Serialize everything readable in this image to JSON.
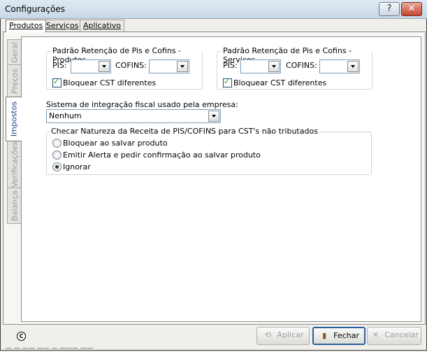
{
  "window": {
    "title": "Configurações",
    "help_btn": "?",
    "close_btn": "✕"
  },
  "top_tabs": [
    "Produtos",
    "Serviços",
    "Aplicativo"
  ],
  "side_tabs": [
    "Geral",
    "Preços",
    "Impostos",
    "Verificações",
    "Balança"
  ],
  "produtos_group": {
    "title": "Padrão Retenção de Pis e Cofins - Produtos",
    "pis_label": "PIS:",
    "pis_value": "",
    "cofins_label": "COFINS:",
    "cofins_value": "",
    "block_label": "Bloquear CST diferentes",
    "block_checked": true
  },
  "servicos_group": {
    "title": "Padrão Retenção de Pis e Cofins - Serviços",
    "pis_label": "PIS:",
    "pis_value": "",
    "cofins_label": "COFINS:",
    "cofins_value": "",
    "block_label": "Bloquear CST diferentes",
    "block_checked": true
  },
  "fiscal": {
    "label": "Sistema de integração fiscal usado pela empresa:",
    "value": "Nenhum"
  },
  "natureza": {
    "title": "Checar Natureza da Receita de PIS/COFINS para CST's não tributados",
    "options": [
      "Bloquear ao salvar produto",
      "Emitir Alerta e pedir confirmação ao salvar produto",
      "Ignorar"
    ],
    "selected": "Ignorar"
  },
  "buttons": {
    "apply": "Aplicar",
    "close": "Fechar",
    "cancel": "Cancelar"
  },
  "stray_text": "— — —— —— — ——— ——"
}
